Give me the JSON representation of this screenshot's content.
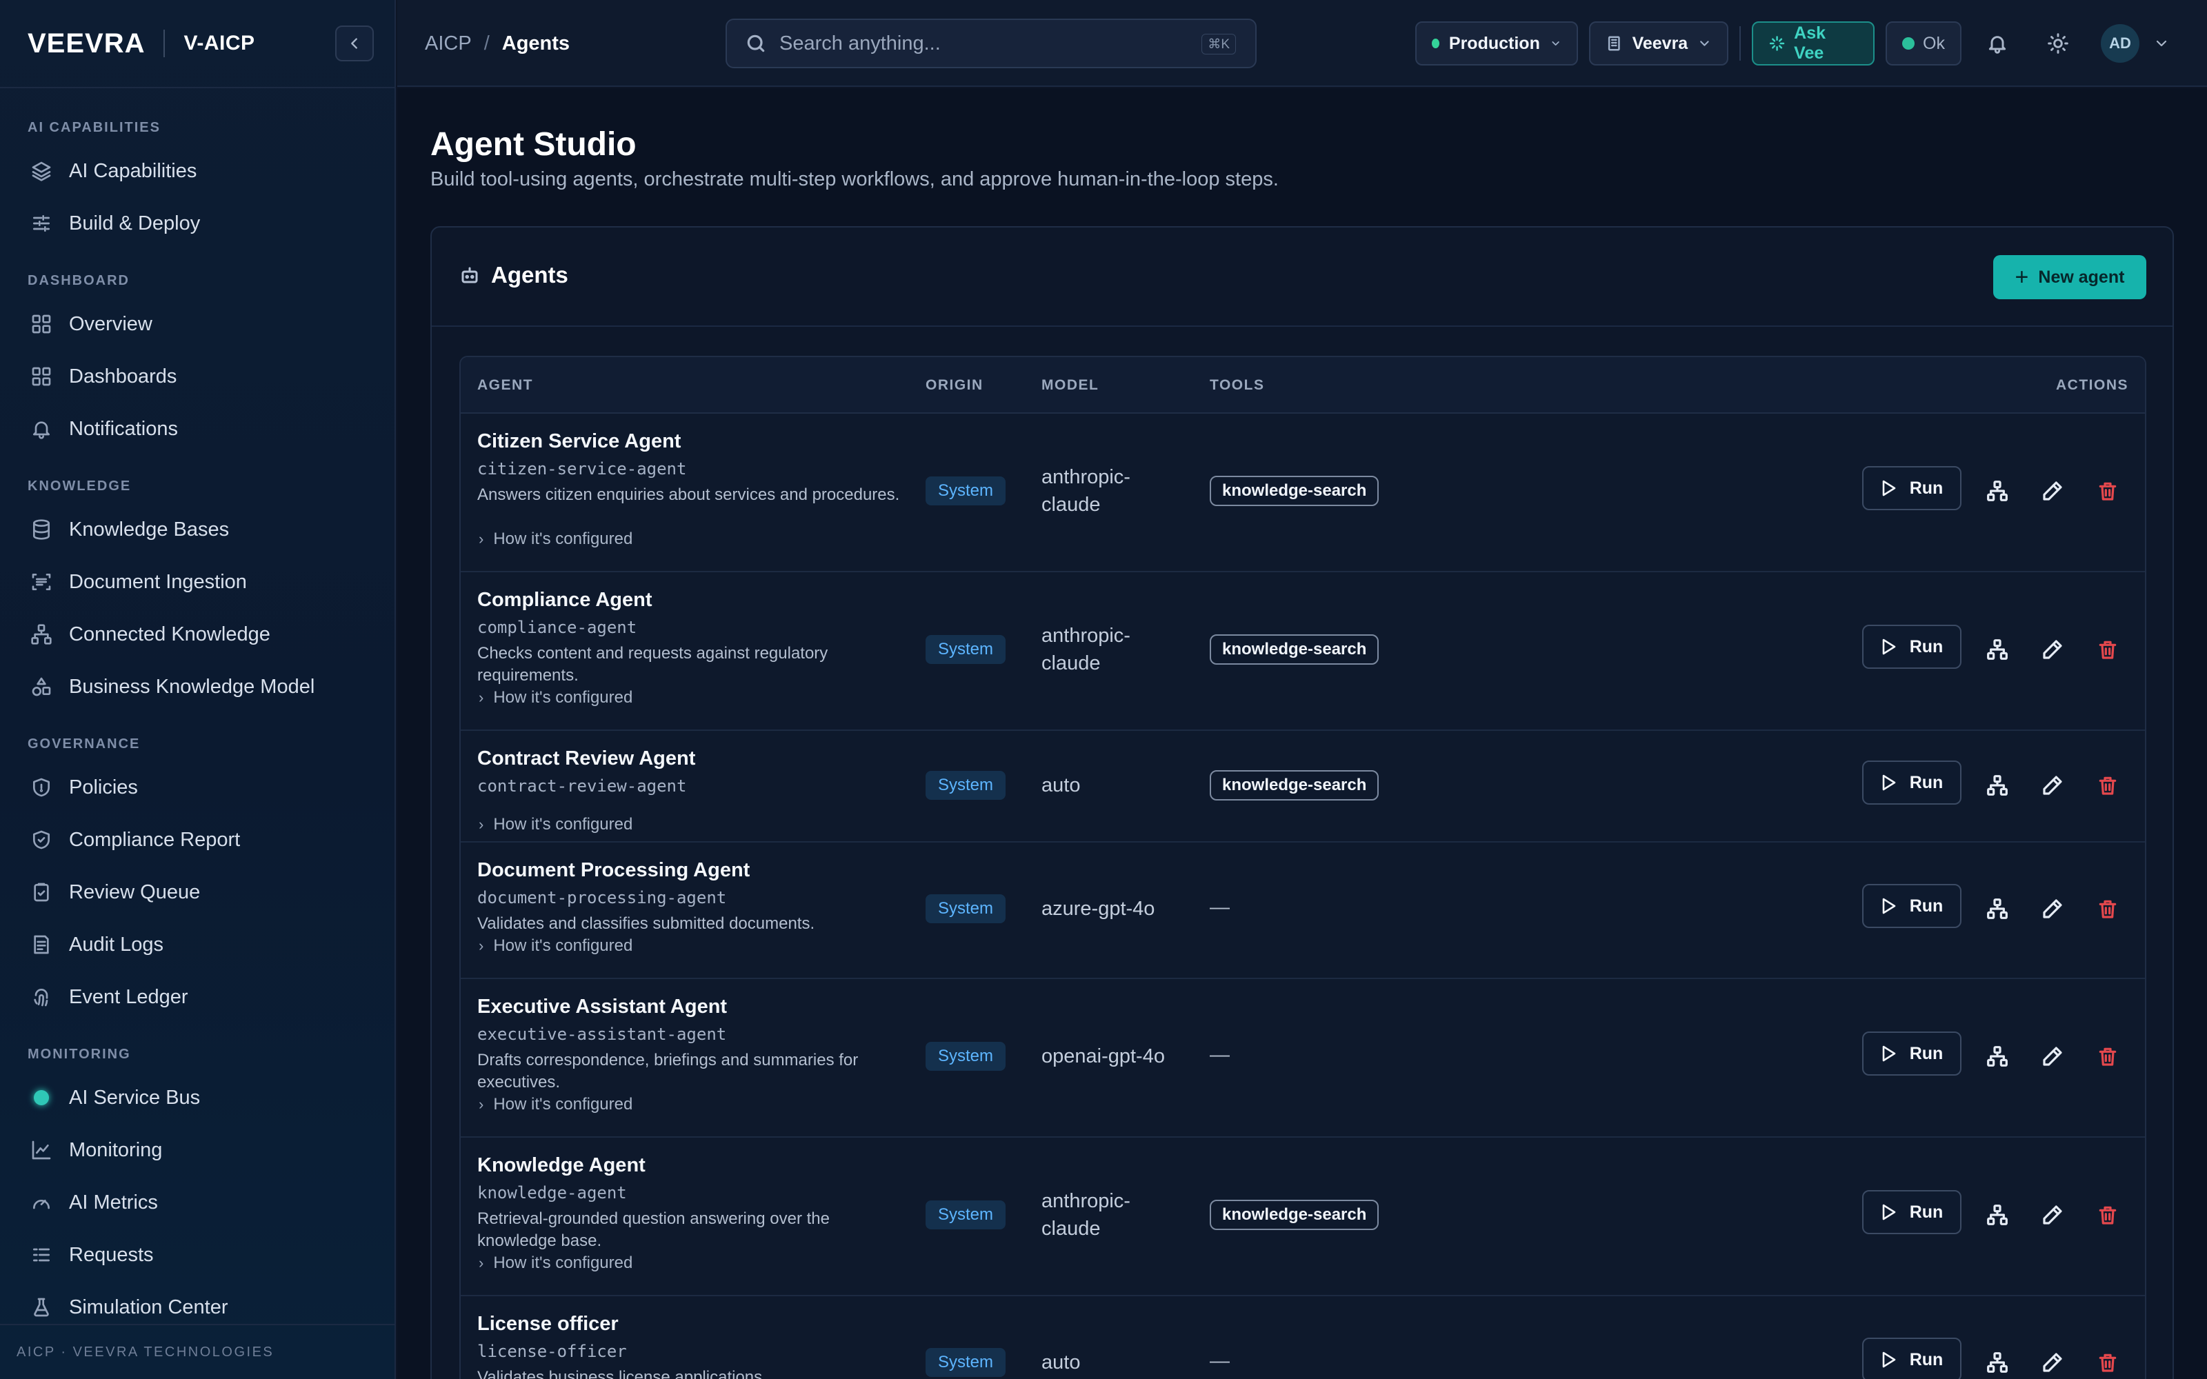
{
  "brand": {
    "logo": "VEEVRA",
    "app": "V-AICP"
  },
  "sidebar": {
    "sections": [
      {
        "title": "AI CAPABILITIES",
        "items": [
          {
            "label": "AI Capabilities",
            "icon": "layers-icon"
          },
          {
            "label": "Build & Deploy",
            "icon": "sliders-icon"
          }
        ]
      },
      {
        "title": "DASHBOARD",
        "items": [
          {
            "label": "Overview",
            "icon": "grid-icon"
          },
          {
            "label": "Dashboards",
            "icon": "grid-icon"
          },
          {
            "label": "Notifications",
            "icon": "bell-icon"
          }
        ]
      },
      {
        "title": "KNOWLEDGE",
        "items": [
          {
            "label": "Knowledge Bases",
            "icon": "database-icon"
          },
          {
            "label": "Document Ingestion",
            "icon": "scan-icon"
          },
          {
            "label": "Connected Knowledge",
            "icon": "network-icon"
          },
          {
            "label": "Business Knowledge Model",
            "icon": "shapes-icon"
          }
        ]
      },
      {
        "title": "GOVERNANCE",
        "items": [
          {
            "label": "Policies",
            "icon": "shield-icon"
          },
          {
            "label": "Compliance Report",
            "icon": "shield-check-icon"
          },
          {
            "label": "Review Queue",
            "icon": "clipboard-icon"
          },
          {
            "label": "Audit Logs",
            "icon": "log-icon"
          },
          {
            "label": "Event Ledger",
            "icon": "fingerprint-icon"
          }
        ]
      },
      {
        "title": "MONITORING",
        "items": [
          {
            "label": "AI Service Bus",
            "icon": "broadcast-icon"
          },
          {
            "label": "Monitoring",
            "icon": "chart-line-icon"
          },
          {
            "label": "AI Metrics",
            "icon": "gauge-icon"
          },
          {
            "label": "Requests",
            "icon": "list-icon"
          },
          {
            "label": "Simulation Center",
            "icon": "flask-icon"
          }
        ]
      }
    ],
    "footer": "AICP · VEEVRA TECHNOLOGIES"
  },
  "topbar": {
    "breadcrumb": {
      "root": "AICP",
      "sep": "/",
      "current": "Agents"
    },
    "search": {
      "placeholder": "Search anything...",
      "shortcut": "⌘K"
    },
    "environment": "Production",
    "tenant": "Veevra",
    "ask": "Ask Vee",
    "status": "Ok",
    "avatar": "AD"
  },
  "page": {
    "title": "Agent Studio",
    "subtitle": "Build tool-using agents, orchestrate multi-step workflows, and approve human-in-the-loop steps."
  },
  "card": {
    "title": "Agents",
    "new_button": "New agent",
    "columns": {
      "agent": "AGENT",
      "origin": "ORIGIN",
      "model": "MODEL",
      "tools": "TOOLS",
      "actions": "ACTIONS"
    },
    "config_label": "How it's configured",
    "run_label": "Run",
    "rows": [
      {
        "name": "Citizen Service Agent",
        "slug": "citizen-service-agent",
        "desc": "Answers citizen enquiries about services and procedures.",
        "origin": "System",
        "model": "anthropic-claude",
        "tool": "knowledge-search"
      },
      {
        "name": "Compliance Agent",
        "slug": "compliance-agent",
        "desc": "Checks content and requests against regulatory requirements.",
        "origin": "System",
        "model": "anthropic-claude",
        "tool": "knowledge-search"
      },
      {
        "name": "Contract Review Agent",
        "slug": "contract-review-agent",
        "desc": "",
        "origin": "System",
        "model": "auto",
        "tool": "knowledge-search"
      },
      {
        "name": "Document Processing Agent",
        "slug": "document-processing-agent",
        "desc": "Validates and classifies submitted documents.",
        "origin": "System",
        "model": "azure-gpt-4o",
        "tool": "—"
      },
      {
        "name": "Executive Assistant Agent",
        "slug": "executive-assistant-agent",
        "desc": "Drafts correspondence, briefings and summaries for executives.",
        "origin": "System",
        "model": "openai-gpt-4o",
        "tool": "—"
      },
      {
        "name": "Knowledge Agent",
        "slug": "knowledge-agent",
        "desc": "Retrieval-grounded question answering over the knowledge base.",
        "origin": "System",
        "model": "anthropic-claude",
        "tool": "knowledge-search"
      },
      {
        "name": "License officer",
        "slug": "license-officer",
        "desc": "Validates business license applications.",
        "origin": "System",
        "model": "auto",
        "tool": "—"
      }
    ]
  },
  "colors": {
    "accent": "#16b3ac",
    "danger": "#e5484d",
    "badge_text": "#5db5ff",
    "live": "#2fc7b6"
  }
}
